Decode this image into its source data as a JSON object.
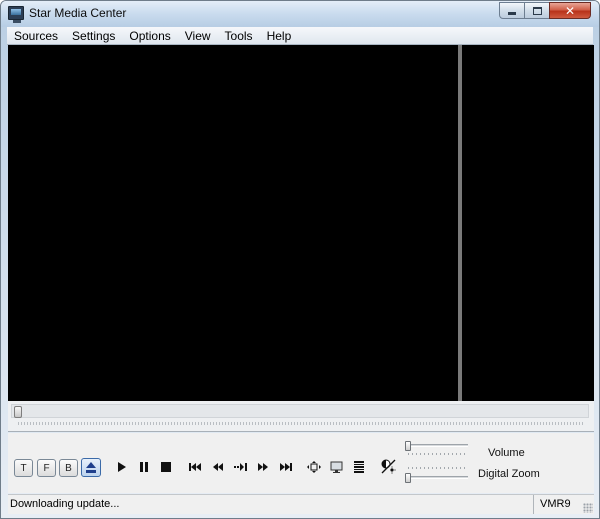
{
  "window": {
    "title": "Star Media Center",
    "close_glyph": "✕"
  },
  "menu": {
    "items": [
      "Sources",
      "Settings",
      "Options",
      "View",
      "Tools",
      "Help"
    ]
  },
  "mode_buttons": [
    "T",
    "F",
    "B"
  ],
  "controls": {
    "volume_label": "Volume",
    "zoom_label": "Digital Zoom",
    "seek_position": 0,
    "volume_level": 0,
    "zoom_level": 0
  },
  "status": {
    "message": "Downloading update...",
    "renderer": "VMR9"
  },
  "icons": [
    "app-icon",
    "eject-icon",
    "play-icon",
    "pause-icon",
    "stop-icon",
    "skip-start-icon",
    "rewind-icon",
    "step-forward-icon",
    "fast-forward-icon",
    "skip-end-icon",
    "move-icon",
    "monitor-icon",
    "playlist-icon",
    "brightness-icon"
  ],
  "colors": {
    "video_bg": "#000000",
    "splitter": "#7a7a7a",
    "close_red": "#c7462b",
    "eject_blue": "#1f3f8c"
  }
}
